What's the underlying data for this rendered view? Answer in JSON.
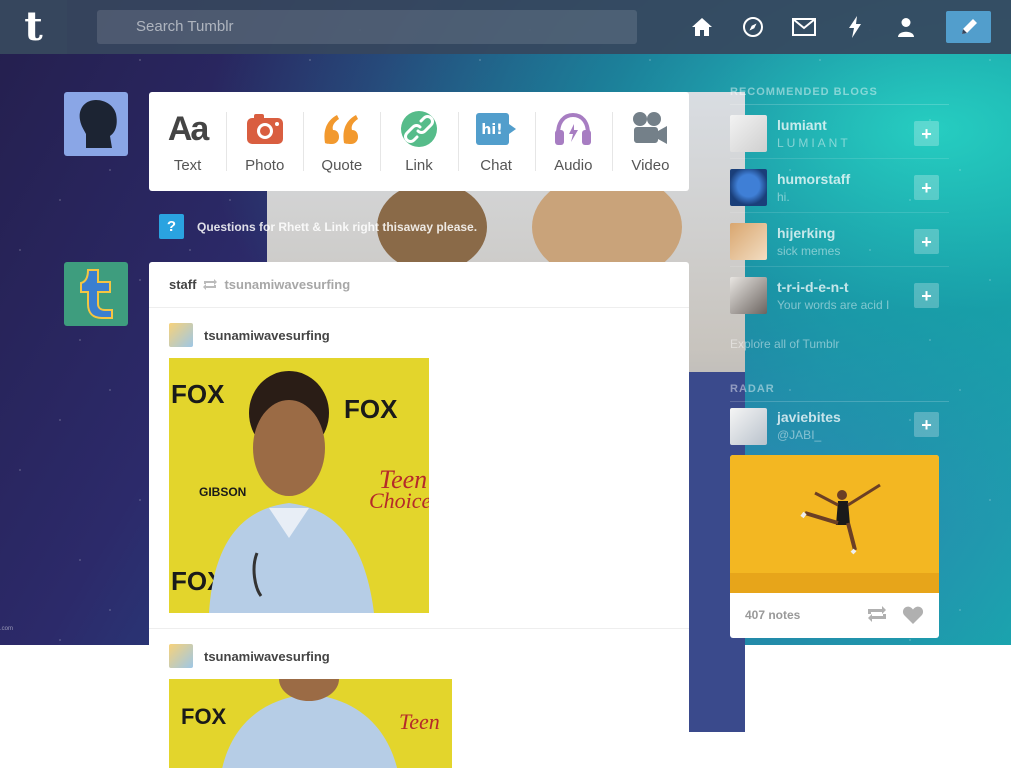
{
  "nav": {
    "logo": "t",
    "search_placeholder": "Search Tumblr",
    "icons": [
      "home-icon",
      "compass-icon",
      "mail-icon",
      "lightning-icon",
      "person-icon",
      "pencil-icon"
    ]
  },
  "post_types": [
    {
      "label": "Text",
      "icon": "text-icon",
      "glyph": "Aa",
      "color": "#444444"
    },
    {
      "label": "Photo",
      "icon": "camera-icon",
      "color": "#d95e40"
    },
    {
      "label": "Quote",
      "icon": "quote-icon",
      "glyph": "66",
      "color": "#f2992e"
    },
    {
      "label": "Link",
      "icon": "link-icon",
      "color": "#56bc8a"
    },
    {
      "label": "Chat",
      "icon": "chat-icon",
      "glyph": "hi!",
      "color": "#529ecc"
    },
    {
      "label": "Audio",
      "icon": "headphones-icon",
      "color": "#a77dc2"
    },
    {
      "label": "Video",
      "icon": "video-camera-icon",
      "color": "#748089"
    }
  ],
  "ask": {
    "icon_glyph": "?",
    "text": "Questions for Rhett & Link right thisaway please."
  },
  "post": {
    "author": "staff",
    "reblogged_from": "tsunamiwavesurfing",
    "entries": [
      {
        "author": "tsunamiwavesurfing"
      },
      {
        "author": "tsunamiwavesurfing"
      }
    ]
  },
  "sidebar": {
    "recommended_title": "RECOMMENDED BLOGS",
    "blogs": [
      {
        "name": "lumiant",
        "subtitle": "LUMIANT"
      },
      {
        "name": "humorstaff",
        "subtitle": "hi."
      },
      {
        "name": "hijerking",
        "subtitle": "sick memes"
      },
      {
        "name": "t-r-i-d-e-n-t",
        "subtitle": "Your words are acid I"
      }
    ],
    "plus_glyph": "+",
    "explore": "Explore all of Tumblr",
    "radar_title": "RADAR",
    "radar_blog": {
      "name": "javiebites",
      "subtitle": "@JABI_"
    },
    "radar_notes": "407 notes"
  },
  "colors": {
    "nav_bg": "#36465d",
    "compose": "#529ecc",
    "ask": "#2aa3e0"
  }
}
